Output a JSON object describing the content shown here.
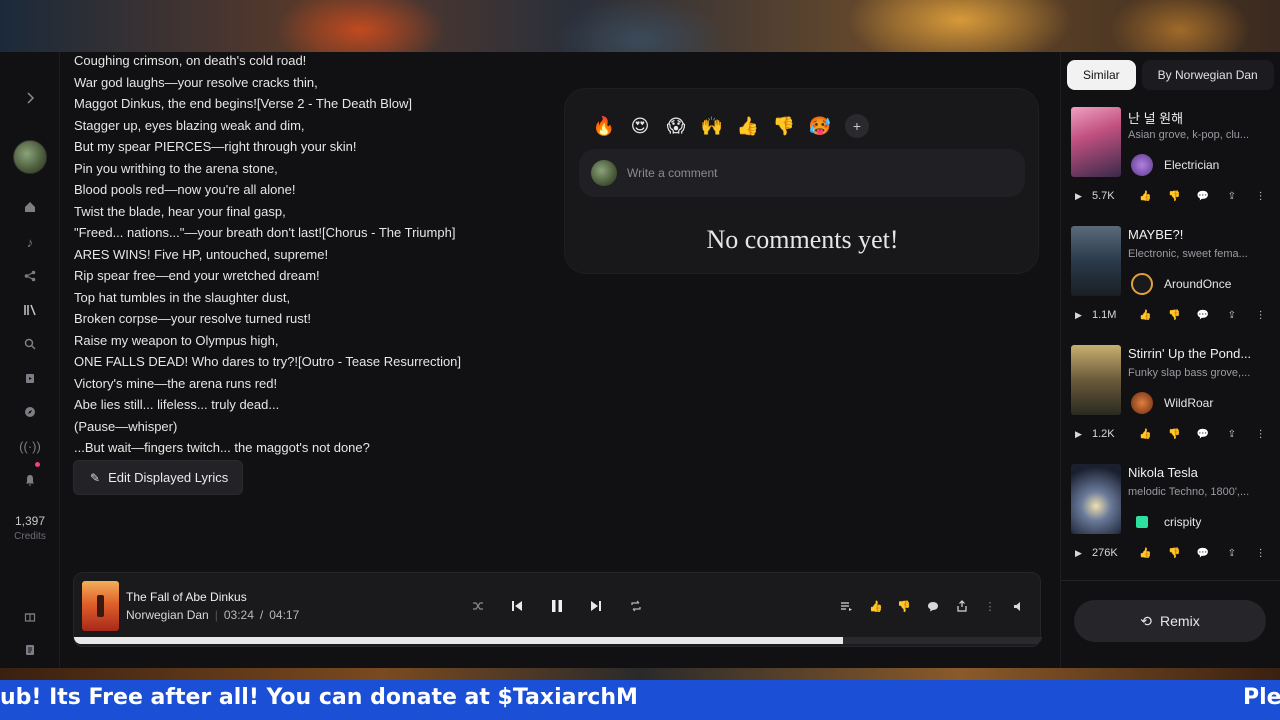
{
  "lyrics": [
    "Coughing crimson, on death's cold road!",
    "War god laughs—your resolve cracks thin,",
    "Maggot Dinkus, the end begins![Verse 2 - The Death Blow]",
    "Stagger up, eyes blazing weak and dim,",
    "But my spear PIERCES—right through your skin!",
    "Pin you writhing to the arena stone,",
    "Blood pools red—now you're all alone!",
    "Twist the blade, hear your final gasp,",
    "\"Freed... nations...\"—your breath don't last![Chorus - The Triumph]",
    "ARES WINS! Five HP, untouched, supreme!",
    "Rip spear free—end your wretched dream!",
    "Top hat tumbles in the slaughter dust,",
    "Broken corpse—your resolve turned rust!",
    "Raise my weapon to Olympus high,",
    "ONE FALLS DEAD! Who dares to try?![Outro - Tease Resurrection]",
    "Victory's mine—the arena runs red!",
    "Abe lies still... lifeless... truly dead...",
    "(Pause—whisper)",
    "...But wait—fingers twitch... the maggot's not done?"
  ],
  "edit_button": {
    "label": "Edit Displayed Lyrics"
  },
  "sidebar": {
    "credits_value": "1,397",
    "credits_label": "Credits"
  },
  "comments": {
    "reactions": [
      "🔥",
      "😍",
      "😱",
      "🙌",
      "👍",
      "👎",
      "🥵"
    ],
    "add_reaction": "+",
    "placeholder": "Write a comment",
    "empty_text": "No comments yet!"
  },
  "player": {
    "title": "The Fall of Abe Dinkus",
    "artist": "Norwegian Dan",
    "current_time": "03:24",
    "separator": "/",
    "duration": "04:17",
    "progress": 0.794
  },
  "right_panel": {
    "tabs": [
      "Similar",
      "By Norwegian Dan"
    ],
    "songs": [
      {
        "title": "난 널 원해",
        "desc": "Asian grove, k-pop, clu...",
        "artist": "Electrician",
        "plays": "5.7K"
      },
      {
        "title": "MAYBE?!",
        "desc": "Electronic, sweet fema...",
        "artist": "AroundOnce",
        "plays": "1.1M"
      },
      {
        "title": "Stirrin' Up the Pond...",
        "desc": "Funky slap bass grove,...",
        "artist": "WildRoar",
        "plays": "1.2K"
      },
      {
        "title": "Nikola Tesla",
        "desc": "melodic Techno, 1800',...",
        "artist": "crispity",
        "plays": "276K"
      }
    ],
    "remix_label": "Remix"
  },
  "ticker": {
    "left_text": "ub! Its Free after all! You can donate at $TaxiarchM",
    "right_text": "Ple"
  },
  "colors": {
    "ticker_bg": "#1a4fd6",
    "background": "#111113",
    "notification_dot": "#e8457a"
  }
}
